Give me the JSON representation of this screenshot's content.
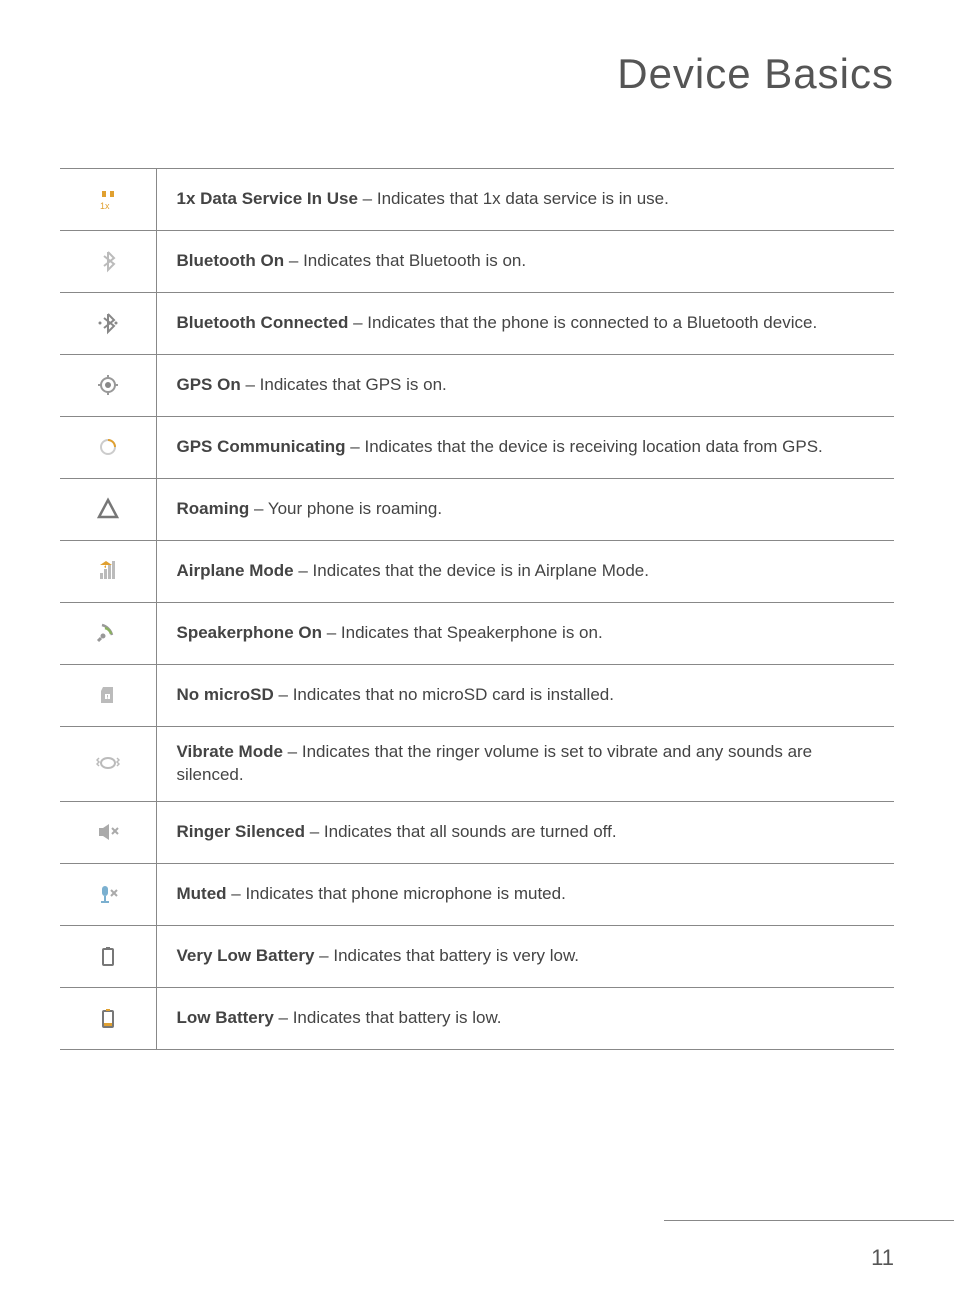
{
  "page_title": "Device Basics",
  "page_number": "11",
  "rows": [
    {
      "icon": "data-1x-icon",
      "term": "1x Data Service In Use",
      "desc": "Indicates that 1x data service is in use."
    },
    {
      "icon": "bluetooth-icon",
      "term": "Bluetooth On",
      "desc": "Indicates that Bluetooth is on."
    },
    {
      "icon": "bluetooth-connected-icon",
      "term": "Bluetooth Connected",
      "desc": "Indicates that the phone is connected to a Bluetooth device."
    },
    {
      "icon": "gps-on-icon",
      "term": "GPS On",
      "desc": "Indicates that GPS is on."
    },
    {
      "icon": "gps-communicating-icon",
      "term": "GPS Communicating",
      "desc": "Indicates that the device is receiving location data from GPS."
    },
    {
      "icon": "roaming-icon",
      "term": "Roaming",
      "desc": "Your phone is roaming."
    },
    {
      "icon": "airplane-mode-icon",
      "term": "Airplane Mode",
      "desc": "Indicates that the device is in Airplane Mode."
    },
    {
      "icon": "speakerphone-icon",
      "term": "Speakerphone On",
      "desc": "Indicates that Speakerphone is on."
    },
    {
      "icon": "no-microsd-icon",
      "term": "No microSD",
      "desc": "Indicates that no microSD card is installed."
    },
    {
      "icon": "vibrate-icon",
      "term": "Vibrate Mode",
      "desc": "Indicates that the ringer volume is set to vibrate and any sounds are silenced."
    },
    {
      "icon": "ringer-silenced-icon",
      "term": "Ringer Silenced",
      "desc": "Indicates that all sounds are turned off."
    },
    {
      "icon": "muted-icon",
      "term": "Muted",
      "desc": "Indicates that phone microphone is muted."
    },
    {
      "icon": "very-low-battery-icon",
      "term": "Very Low Battery",
      "desc": "Indicates that battery is very low."
    },
    {
      "icon": "low-battery-icon",
      "term": "Low Battery",
      "desc": "Indicates that battery is low."
    }
  ]
}
